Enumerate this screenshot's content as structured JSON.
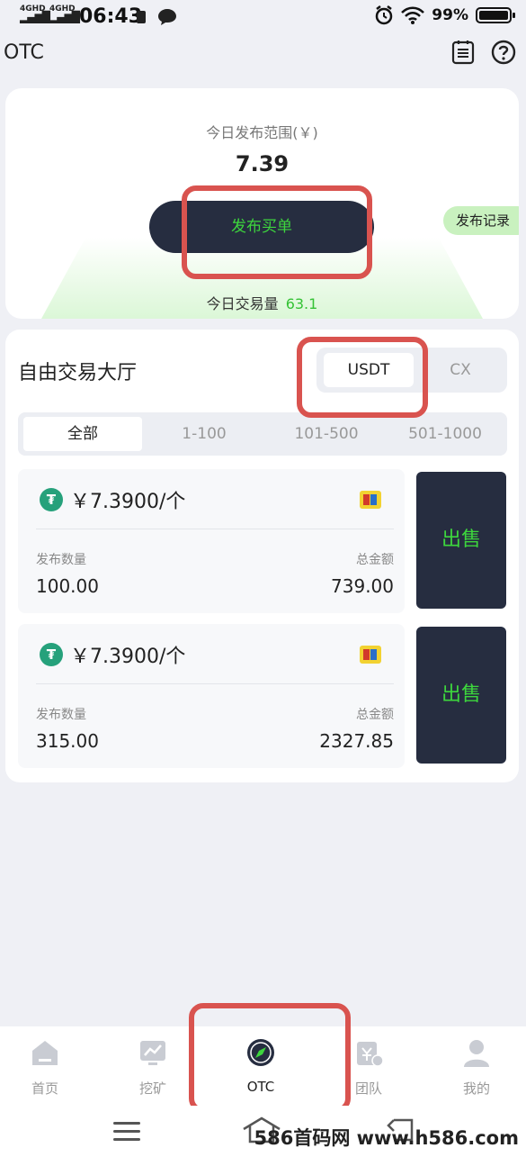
{
  "status_bar": {
    "sim1": "4GHD",
    "sim2": "4GHD",
    "time": "06:43",
    "battery_pct": "99%",
    "battery_level": 0.99
  },
  "header": {
    "title": "OTC",
    "icons": [
      "orders-icon",
      "help-icon"
    ]
  },
  "publish": {
    "range_label": "今日发布范围(￥)",
    "range_value": "7.39",
    "buy_button": "发布买单",
    "record_button": "发布记录",
    "volume_label": "今日交易量",
    "volume_value": "63.1"
  },
  "hall": {
    "title": "自由交易大厅",
    "coins": [
      "USDT",
      "CX"
    ],
    "active_coin": "USDT",
    "ranges": [
      "全部",
      "1-100",
      "101-500",
      "501-1000"
    ],
    "active_range": "全部",
    "offers": [
      {
        "coin_symbol": "₮",
        "price": "￥7.3900/个",
        "qty_label": "发布数量",
        "qty": "100.00",
        "amount_label": "总金额",
        "amount": "739.00",
        "action": "出售"
      },
      {
        "coin_symbol": "₮",
        "price": "￥7.3900/个",
        "qty_label": "发布数量",
        "qty": "315.00",
        "amount_label": "总金额",
        "amount": "2327.85",
        "action": "出售"
      }
    ]
  },
  "nav": {
    "items": [
      {
        "label": "首页",
        "icon": "home-icon"
      },
      {
        "label": "挖矿",
        "icon": "mining-icon"
      },
      {
        "label": "OTC",
        "icon": "compass-icon"
      },
      {
        "label": "团队",
        "icon": "team-icon"
      },
      {
        "label": "我的",
        "icon": "profile-icon"
      }
    ],
    "active": "OTC"
  },
  "watermark": "586首码网 www.h586.com",
  "colors": {
    "accent_green": "#3dd63d",
    "dark_button": "#262d40",
    "annotation_red": "#d9534f",
    "tether_green": "#26a17b"
  }
}
